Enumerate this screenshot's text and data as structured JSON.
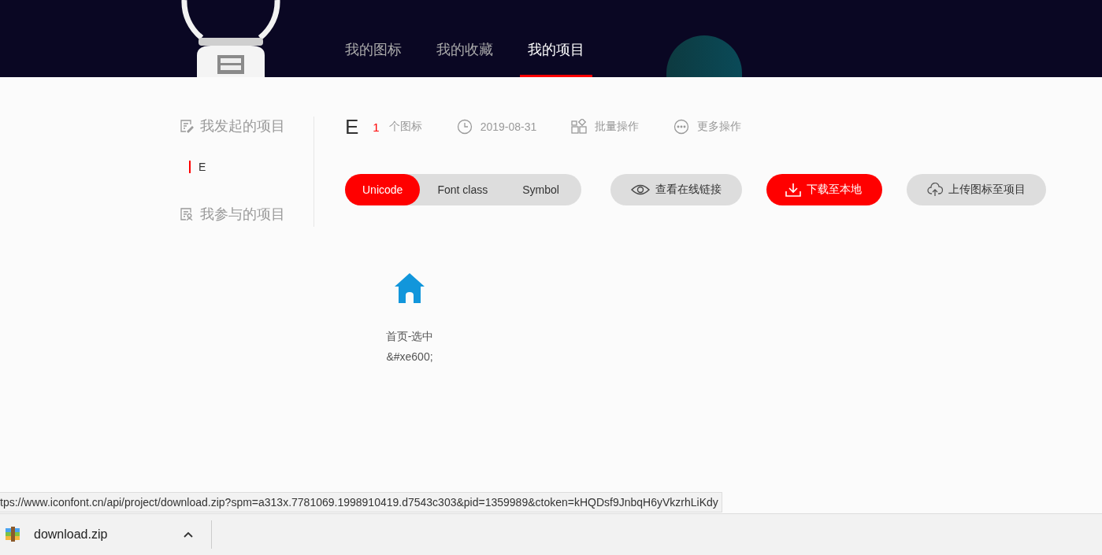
{
  "nav": {
    "tabs": [
      {
        "label": "我的图标",
        "selected": false
      },
      {
        "label": "我的收藏",
        "selected": false
      },
      {
        "label": "我的项目",
        "selected": true
      }
    ]
  },
  "sidebar": {
    "sections": [
      {
        "title": "我发起的项目",
        "kind": "created",
        "projects": [
          {
            "name": "E",
            "selected": true
          }
        ]
      },
      {
        "title": "我参与的项目",
        "kind": "joined"
      }
    ]
  },
  "project": {
    "name": "E",
    "icon_count": "1",
    "count_label": "个图标",
    "date": "2019-08-31",
    "batch_label": "批量操作",
    "more_label": "更多操作"
  },
  "modes": [
    {
      "label": "Unicode",
      "selected": true
    },
    {
      "label": "Font class",
      "selected": false
    },
    {
      "label": "Symbol",
      "selected": false
    }
  ],
  "actions": [
    {
      "label": "查看在线链接",
      "kind": "view"
    },
    {
      "label": "下载至本地",
      "kind": "download"
    },
    {
      "label": "上传图标至项目",
      "kind": "upload"
    }
  ],
  "icons": [
    {
      "name": "首页-选中",
      "code": "&#xe600;"
    }
  ],
  "status_url": "tps://www.iconfont.cn/api/project/download.zip?spm=a313x.7781069.1998910419.d7543c303&pid=1359989&ctoken=kHQDsf9JnbqH6yVkzrhLiKdy",
  "downloads": [
    {
      "filename": "download.zip"
    }
  ]
}
